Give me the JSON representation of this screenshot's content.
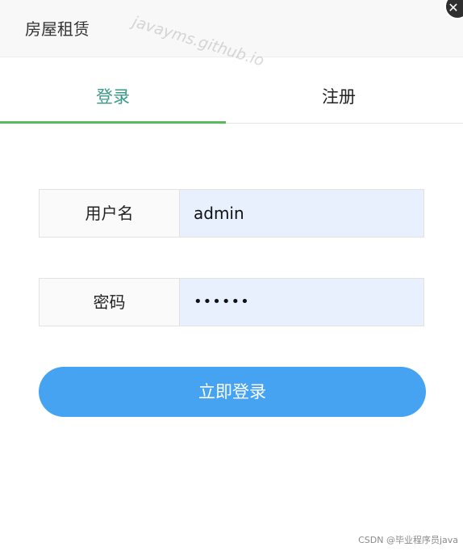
{
  "window": {
    "title": "房屋租赁",
    "close_icon": "✕"
  },
  "watermark": "javayms.github.io",
  "tabs": [
    {
      "label": "登录",
      "active": true
    },
    {
      "label": "注册",
      "active": false
    }
  ],
  "form": {
    "username": {
      "label": "用户名",
      "value": "admin"
    },
    "password": {
      "label": "密码",
      "value": "••••••"
    },
    "submit_label": "立即登录"
  },
  "credit": "CSDN @毕业程序员java",
  "colors": {
    "active_tab_text": "#3a9a8a",
    "active_tab_indicator": "#5cb85c",
    "button": "#45a3f2",
    "autofill_bg": "#e8f0fe"
  }
}
